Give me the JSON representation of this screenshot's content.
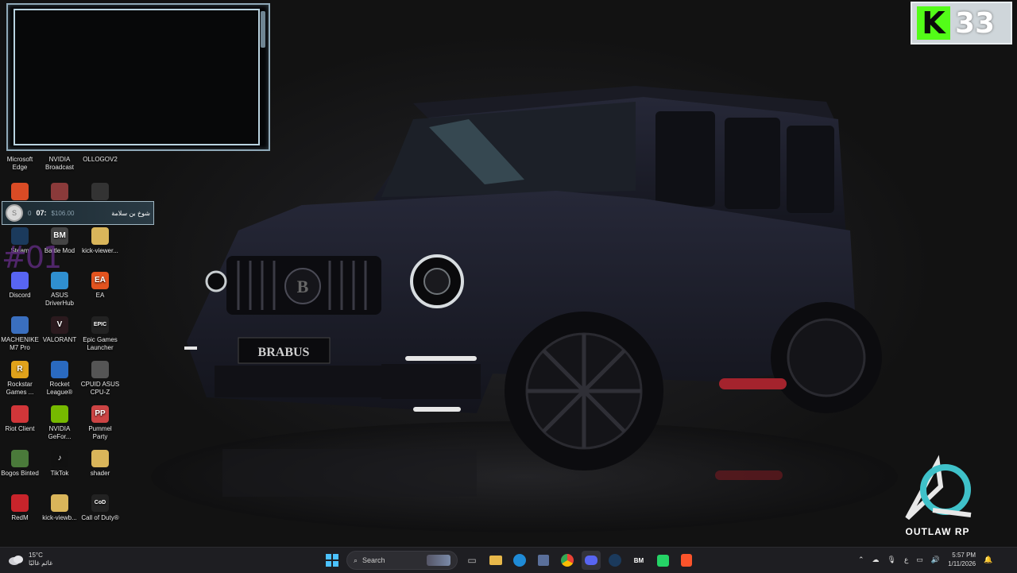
{
  "desktop": {
    "icons": [
      {
        "label": "Microsoft Edge",
        "icon": "edge-icon",
        "color": "#1e6fbf",
        "glyph": ""
      },
      {
        "label": "NVIDIA Broadcast",
        "icon": "nvidia-broadcast-icon",
        "color": "#3b3b3b",
        "glyph": ""
      },
      {
        "label": "OLLOGOV2",
        "icon": "ollogov2-icon",
        "color": "#2a2a2a",
        "glyph": ""
      },
      {
        "label": "",
        "icon": "brave-icon",
        "color": "#d94b25",
        "glyph": ""
      },
      {
        "label": "",
        "icon": "app-icon",
        "color": "#8a3a3a",
        "glyph": ""
      },
      {
        "label": "",
        "icon": "app-icon",
        "color": "#333",
        "glyph": ""
      },
      {
        "label": "Steam",
        "icon": "steam-icon",
        "color": "#1b3a5c",
        "glyph": ""
      },
      {
        "label": "Battle Mod",
        "icon": "battle-mod-icon",
        "color": "#444",
        "glyph": "BM"
      },
      {
        "label": "kick-viewer...",
        "icon": "folder-icon",
        "color": "#d9b55a",
        "glyph": ""
      },
      {
        "label": "Discord",
        "icon": "discord-icon",
        "color": "#5865f2",
        "glyph": ""
      },
      {
        "label": "ASUS DriverHub",
        "icon": "asus-driverhub-icon",
        "color": "#2f8fd0",
        "glyph": ""
      },
      {
        "label": "EA",
        "icon": "ea-icon",
        "color": "#e2531f",
        "glyph": "EA"
      },
      {
        "label": "MACHENIKE M7 Pro",
        "icon": "machenike-icon",
        "color": "#3a6fbf",
        "glyph": ""
      },
      {
        "label": "VALORANT",
        "icon": "valorant-icon",
        "color": "#2b1a1e",
        "glyph": "V"
      },
      {
        "label": "Epic Games Launcher",
        "icon": "epic-games-icon",
        "color": "#222",
        "glyph": "EPIC"
      },
      {
        "label": "Rockstar Games ...",
        "icon": "rockstar-icon",
        "color": "#e0a21b",
        "glyph": "R"
      },
      {
        "label": "Rocket League®",
        "icon": "rocket-league-icon",
        "color": "#2a6ac0",
        "glyph": ""
      },
      {
        "label": "CPUID ASUS CPU-Z",
        "icon": "cpuz-icon",
        "color": "#555",
        "glyph": ""
      },
      {
        "label": "Riot Client",
        "icon": "riot-client-icon",
        "color": "#d13639",
        "glyph": ""
      },
      {
        "label": "NVIDIA GeFor...",
        "icon": "nvidia-geforce-icon",
        "color": "#76b900",
        "glyph": ""
      },
      {
        "label": "Pummel Party",
        "icon": "pummel-party-icon",
        "color": "#c44",
        "glyph": "PP"
      },
      {
        "label": "Bogos Binted",
        "icon": "bogos-binted-icon",
        "color": "#4a7a3a",
        "glyph": ""
      },
      {
        "label": "TikTok",
        "icon": "tiktok-icon",
        "color": "#111",
        "glyph": "♪"
      },
      {
        "label": "shader",
        "icon": "folder-icon",
        "color": "#d9b55a",
        "glyph": ""
      },
      {
        "label": "RedM",
        "icon": "redm-icon",
        "color": "#c8242b",
        "glyph": ""
      },
      {
        "label": "kick-viewb...",
        "icon": "folder-icon",
        "color": "#d9b55a",
        "glyph": ""
      },
      {
        "label": "Call of Duty®",
        "icon": "call-of-duty-icon",
        "color": "#222",
        "glyph": "CoD"
      }
    ]
  },
  "overlay": {
    "notification": {
      "time": "07:",
      "price": "$106.00",
      "name": "شوخ بن سلامة",
      "prefix": "0",
      "avatar_glyph": "S"
    },
    "stream_number": "#01",
    "kick": {
      "logo": "K",
      "count": "33"
    },
    "brand": {
      "title": "OUTLAW RP"
    }
  },
  "taskbar": {
    "weather": {
      "temp": "15°C",
      "condition": "غائم غالبًا"
    },
    "search_placeholder": "Search",
    "apps": [
      "start-icon",
      "search",
      "task-view-icon",
      "file-explorer-icon",
      "edge-icon",
      "store-icon",
      "chrome-icon",
      "discord-icon",
      "steam-icon",
      "battle-mod-icon",
      "whatsapp-icon",
      "brave-icon"
    ],
    "tray": {
      "language": "ع",
      "time": "5:57 PM",
      "date": "1/11/2026"
    }
  },
  "colors": {
    "kick_green": "#53fc18",
    "frame": "#b9d3e0",
    "taskbar": "#1e1e22"
  }
}
